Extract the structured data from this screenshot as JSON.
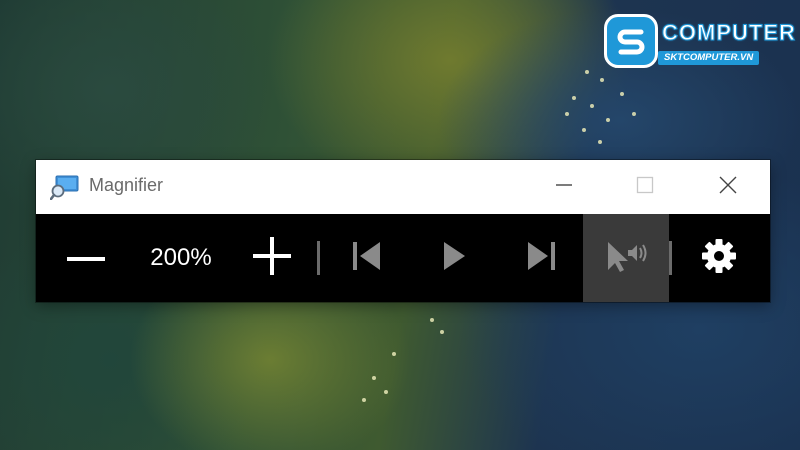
{
  "logo": {
    "wordmark": "COMPUTER",
    "url": "SKTCOMPUTER.VN",
    "icon": "sk-logo-icon"
  },
  "window": {
    "title": "Magnifier",
    "app_icon": "magnifier-app-icon",
    "controls": {
      "minimize": "minimize-icon",
      "maximize": "maximize-icon",
      "close": "close-icon"
    }
  },
  "toolbar": {
    "zoom_out": "minus-icon",
    "zoom_level": "200%",
    "zoom_in": "plus-icon",
    "previous": "skip-previous-icon",
    "play": "play-icon",
    "next": "skip-next-icon",
    "read_from_pointer": "pointer-speaker-icon",
    "settings": "gear-icon"
  },
  "colors": {
    "titlebar_bg": "#ffffff",
    "toolbar_bg": "#000000",
    "active_button_bg": "#3a3a3a",
    "icon_disabled": "#8a8a8a",
    "logo_blue": "#1f98d8"
  }
}
